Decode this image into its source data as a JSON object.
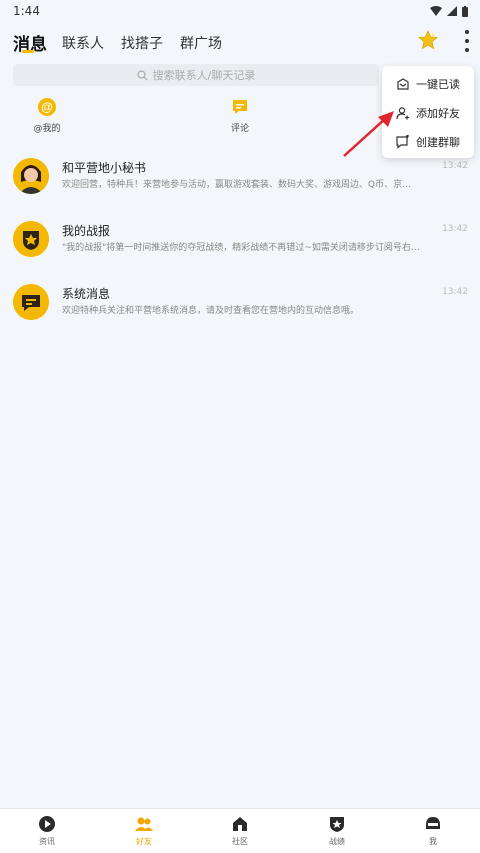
{
  "status_bar": {
    "time": "1:44"
  },
  "tabs": [
    {
      "label": "消息",
      "active": true
    },
    {
      "label": "联系人",
      "active": false
    },
    {
      "label": "找搭子",
      "active": false
    },
    {
      "label": "群广场",
      "active": false
    }
  ],
  "search": {
    "placeholder": "搜索联系人/聊天记录"
  },
  "shortcuts": [
    {
      "label": "@我的",
      "icon": "at-icon"
    },
    {
      "label": "评论",
      "icon": "comment-icon"
    }
  ],
  "messages": [
    {
      "title": "和平营地小秘书",
      "preview": "欢迎回营，特种兵！来营地参与活动，赢取游戏套装、数码大奖、游戏周边、Q币、京…",
      "time": "13:42",
      "avatar": "assistant-avatar"
    },
    {
      "title": "我的战报",
      "preview": "\"我的战报\"将第一时间推送你的夺冠战绩，精彩战绩不再错过~如需关闭请移步订阅号右…",
      "time": "13:42",
      "avatar": "battle-report-avatar"
    },
    {
      "title": "系统消息",
      "preview": "欢迎特种兵关注和平营地系统消息，请及时查看您在营地内的互动信息哦。",
      "time": "13:42",
      "avatar": "system-message-avatar"
    }
  ],
  "popup_menu": {
    "items": [
      {
        "label": "一键已读",
        "icon": "mark-read-icon"
      },
      {
        "label": "添加好友",
        "icon": "add-friend-icon"
      },
      {
        "label": "创建群聊",
        "icon": "create-group-icon"
      }
    ]
  },
  "bottom_nav": [
    {
      "label": "资讯",
      "active": false
    },
    {
      "label": "好友",
      "active": true
    },
    {
      "label": "社区",
      "active": false
    },
    {
      "label": "战绩",
      "active": false
    },
    {
      "label": "我",
      "active": false
    }
  ],
  "colors": {
    "accent": "#f5b800",
    "background": "#f3f6fa",
    "arrow": "#e0262f"
  }
}
